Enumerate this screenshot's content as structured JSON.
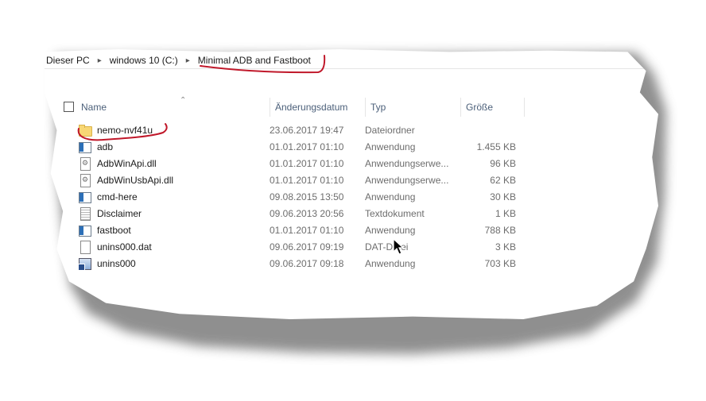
{
  "breadcrumb": [
    "Dieser PC",
    "windows 10 (C:)",
    "Minimal ADB and Fastboot"
  ],
  "columns": {
    "name": "Name",
    "date": "Änderungsdatum",
    "type": "Typ",
    "size": "Größe"
  },
  "files": [
    {
      "name": "nemo-nvf41u",
      "date": "23.06.2017 19:47",
      "type": "Dateiordner",
      "size": "",
      "icon": "folder-icon"
    },
    {
      "name": "adb",
      "date": "01.01.2017 01:10",
      "type": "Anwendung",
      "size": "1.455 KB",
      "icon": "app-icon"
    },
    {
      "name": "AdbWinApi.dll",
      "date": "01.01.2017 01:10",
      "type": "Anwendungserwe...",
      "size": "96 KB",
      "icon": "dll-icon"
    },
    {
      "name": "AdbWinUsbApi.dll",
      "date": "01.01.2017 01:10",
      "type": "Anwendungserwe...",
      "size": "62 KB",
      "icon": "dll-icon"
    },
    {
      "name": "cmd-here",
      "date": "09.08.2015 13:50",
      "type": "Anwendung",
      "size": "30 KB",
      "icon": "app-icon"
    },
    {
      "name": "Disclaimer",
      "date": "09.06.2013 20:56",
      "type": "Textdokument",
      "size": "1 KB",
      "icon": "text-icon"
    },
    {
      "name": "fastboot",
      "date": "01.01.2017 01:10",
      "type": "Anwendung",
      "size": "788 KB",
      "icon": "app-icon"
    },
    {
      "name": "unins000.dat",
      "date": "09.06.2017 09:19",
      "type": "DAT-Datei",
      "size": "3 KB",
      "icon": "blank-icon"
    },
    {
      "name": "unins000",
      "date": "09.06.2017 09:18",
      "type": "Anwendung",
      "size": "703 KB",
      "icon": "uninst-icon"
    }
  ],
  "colors": {
    "annotation": "#c0182a",
    "header_text": "#4c607a",
    "folder": "#f8d775"
  }
}
